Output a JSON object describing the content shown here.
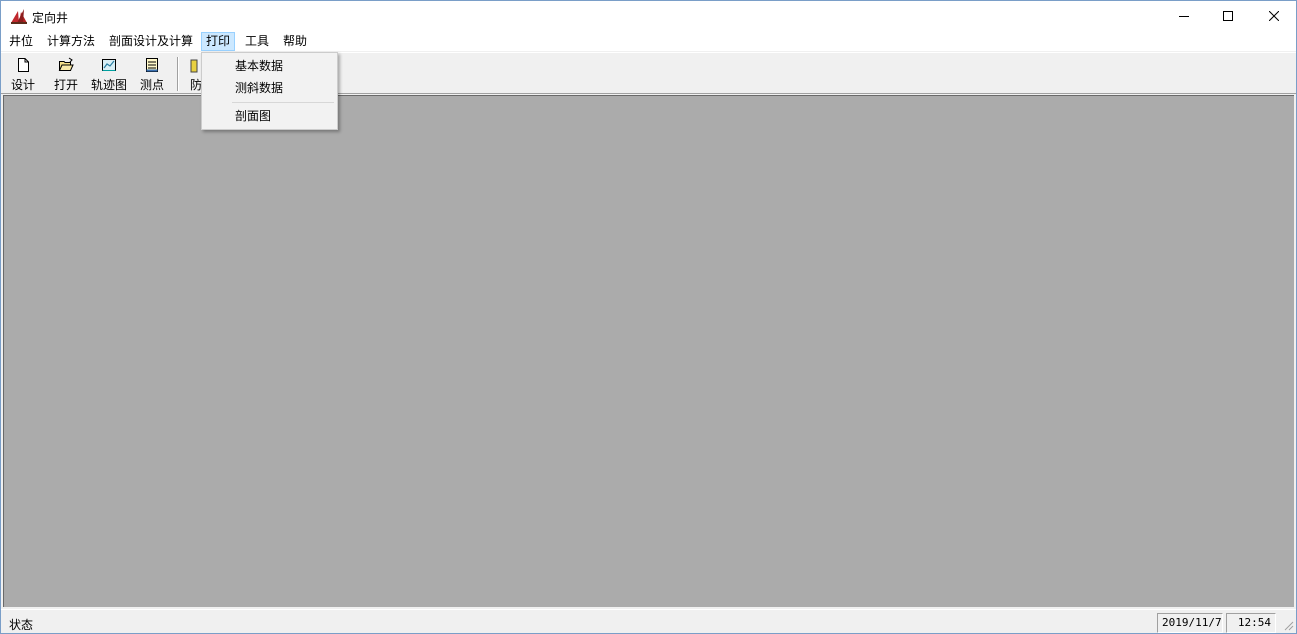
{
  "window": {
    "title": "定向井"
  },
  "menu": [
    {
      "label": "井位"
    },
    {
      "label": "计算方法"
    },
    {
      "label": "剖面设计及计算"
    },
    {
      "label": "打印",
      "active": true
    },
    {
      "label": "工具"
    },
    {
      "label": "帮助"
    }
  ],
  "toolbar": {
    "design": "设计",
    "open": "打开",
    "trajectory": "轨迹图",
    "survey": "测点",
    "collision": "防"
  },
  "print_menu": {
    "items": [
      "基本数据",
      "测斜数据",
      "剖面图"
    ]
  },
  "status": {
    "text": "状态",
    "date": "2019/11/7",
    "time": "12:54"
  },
  "colors": {
    "client_bg": "#ababab",
    "menu_highlight": "#cce8ff",
    "chrome": "#f0f0f0"
  }
}
